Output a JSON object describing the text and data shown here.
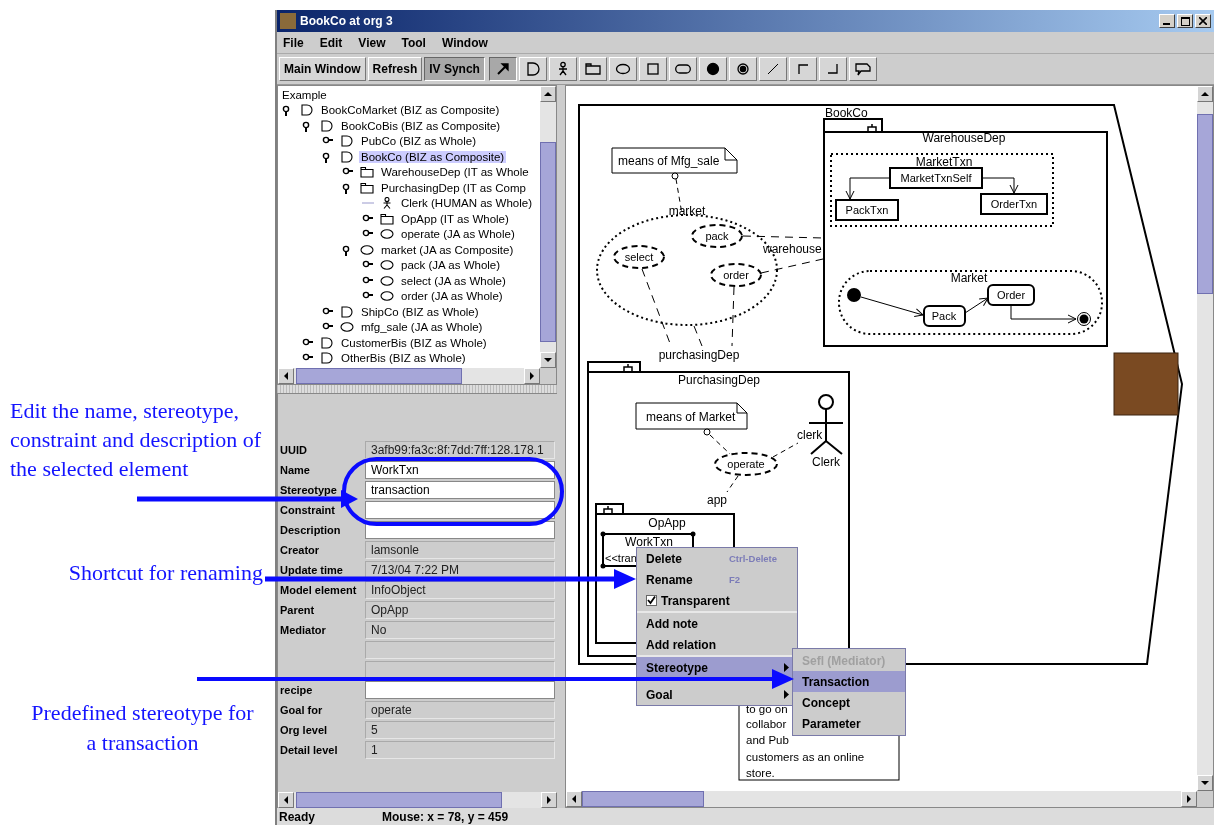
{
  "annotations": [
    "Edit the name, stereotype, constraint and description of the selected element",
    "Shortcut for renaming",
    "Predefined stereotype for a transaction"
  ],
  "window": {
    "title": "BookCo at org 3"
  },
  "menu": [
    "File",
    "Edit",
    "View",
    "Tool",
    "Window"
  ],
  "toolbar": {
    "buttons": [
      {
        "label": "Main Window",
        "pressed": false
      },
      {
        "label": "Refresh",
        "pressed": false
      },
      {
        "label": "IV Synch",
        "pressed": true
      }
    ],
    "tools": [
      {
        "kind": "pointer",
        "selected": true
      },
      {
        "kind": "business",
        "selected": false
      },
      {
        "kind": "actor",
        "selected": false
      },
      {
        "kind": "package",
        "selected": false
      },
      {
        "kind": "ellipse",
        "selected": false
      },
      {
        "kind": "square",
        "selected": false
      },
      {
        "kind": "rounded",
        "selected": false
      },
      {
        "kind": "initial",
        "selected": false
      },
      {
        "kind": "final",
        "selected": false
      },
      {
        "kind": "line",
        "selected": false
      },
      {
        "kind": "corner-top",
        "selected": false
      },
      {
        "kind": "corner-bottom",
        "selected": false
      },
      {
        "kind": "note",
        "selected": false
      }
    ]
  },
  "tree": {
    "root": "Example",
    "items": [
      {
        "label": "BookCoMarket (BIZ as Composite)",
        "kind": "biz",
        "expanded": true,
        "selected": false,
        "children": [
          {
            "label": "BookCoBis (BIZ as Composite)",
            "kind": "biz",
            "expanded": true,
            "selected": false,
            "children": [
              {
                "label": "PubCo (BIZ as Whole)",
                "kind": "biz",
                "expanded": false,
                "selected": false
              },
              {
                "label": "BookCo (BIZ as Composite)",
                "kind": "biz",
                "expanded": true,
                "selected": true,
                "children": [
                  {
                    "label": "WarehouseDep (IT as Whole",
                    "kind": "it",
                    "expanded": false,
                    "selected": false
                  },
                  {
                    "label": "PurchasingDep (IT as Comp",
                    "kind": "it",
                    "expanded": true,
                    "selected": false,
                    "children": [
                      {
                        "label": "Clerk (HUMAN as Whole)",
                        "kind": "human",
                        "selected": false
                      },
                      {
                        "label": "OpApp (IT as Whole)",
                        "kind": "it",
                        "expanded": false,
                        "selected": false
                      },
                      {
                        "label": "operate (JA as Whole)",
                        "kind": "ja",
                        "expanded": false,
                        "selected": false
                      }
                    ]
                  },
                  {
                    "label": "market (JA as Composite)",
                    "kind": "ja",
                    "expanded": true,
                    "selected": false,
                    "children": [
                      {
                        "label": "pack (JA as Whole)",
                        "kind": "ja",
                        "expanded": false,
                        "selected": false
                      },
                      {
                        "label": "select (JA as Whole)",
                        "kind": "ja",
                        "expanded": false,
                        "selected": false
                      },
                      {
                        "label": "order (JA as Whole)",
                        "kind": "ja",
                        "expanded": false,
                        "selected": false
                      }
                    ]
                  }
                ]
              },
              {
                "label": "ShipCo (BIZ as Whole)",
                "kind": "biz",
                "expanded": false,
                "selected": false
              },
              {
                "label": "mfg_sale (JA as Whole)",
                "kind": "ja",
                "expanded": false,
                "selected": false
              }
            ]
          },
          {
            "label": "CustomerBis (BIZ as Whole)",
            "kind": "biz",
            "expanded": false,
            "selected": false
          },
          {
            "label": "OtherBis (BIZ as Whole)",
            "kind": "biz",
            "expanded": false,
            "selected": false
          }
        ]
      }
    ]
  },
  "properties": [
    {
      "label": "UUID",
      "value": "3afb99:fa3c:8f:7dd:7ff:128.178.1",
      "editable": false
    },
    {
      "label": "Name",
      "value": "WorkTxn",
      "editable": true
    },
    {
      "label": "Stereotype",
      "value": "transaction",
      "editable": true
    },
    {
      "label": "Constraint",
      "editable": true
    },
    {
      "label": "Description",
      "editable": true
    },
    {
      "label": "Creator",
      "value": "lamsonle",
      "editable": false
    },
    {
      "label": "Update time",
      "value": "7/13/04 7:22 PM",
      "editable": false
    },
    {
      "label": "Model element",
      "value": "InfoObject",
      "editable": false
    },
    {
      "label": "Parent",
      "value": "OpApp",
      "editable": false
    },
    {
      "label": "Mediator",
      "value": "No",
      "editable": false
    },
    {
      "editable": false
    },
    {
      "editable": false
    },
    {
      "label": "recipe",
      "editable": true
    },
    {
      "label": "Goal for",
      "value": "operate",
      "editable": false
    },
    {
      "label": "Org level",
      "value": "5",
      "editable": false
    },
    {
      "label": "Detail level",
      "value": "1",
      "editable": false
    }
  ],
  "diagram": {
    "bookco": {
      "title": "BookCo",
      "label": "WarehouseDep",
      "composite": {
        "label": "MarketTxn",
        "parent": "MarketTxnSelf",
        "children": [
          "PackTxn",
          "OrderTxn"
        ]
      },
      "statechart": {
        "label": "Market",
        "states": [
          "Pack",
          "Order"
        ]
      }
    },
    "market_note": "means of Mfg_sale",
    "market": {
      "label": "market",
      "actions": [
        "pack",
        "select",
        "order"
      ]
    },
    "roles": [
      "warehouse",
      "purchasingDep"
    ],
    "purchasing": {
      "label": "PurchasingDep",
      "note": "means of Market",
      "action": "operate",
      "clerk_role": "clerk",
      "actor": "Clerk",
      "app_role": "app",
      "opapp": {
        "label": "OpApp",
        "object": "WorkTxn",
        "stereotype": "<<tran"
      }
    },
    "note_fragment": [
      "to go on",
      "collabor",
      "and Pub",
      "customers as an online",
      "store."
    ]
  },
  "context_menu": {
    "groups": [
      [
        {
          "label": "Delete",
          "shortcut": "Ctrl-Delete",
          "kind": "action",
          "selected": false
        },
        {
          "label": "Rename",
          "shortcut": "F2",
          "kind": "action",
          "selected": false
        },
        {
          "label": "Transparent",
          "kind": "check",
          "checked": true,
          "selected": false
        }
      ],
      [
        {
          "label": "Add note",
          "kind": "action",
          "selected": false
        },
        {
          "label": "Add relation",
          "kind": "action",
          "selected": false
        }
      ],
      [
        {
          "label": "Stereotype",
          "kind": "submenu",
          "selected": true
        },
        {
          "label": "Goal",
          "kind": "submenu",
          "selected": false
        }
      ]
    ],
    "submenu": [
      {
        "label": "Sefl (Mediator)",
        "selected": false,
        "disabled": true
      },
      {
        "label": "Transaction",
        "selected": true,
        "disabled": false
      },
      {
        "label": "Concept",
        "selected": false,
        "disabled": false
      },
      {
        "label": "Parameter",
        "selected": false,
        "disabled": false
      }
    ]
  },
  "status_bar": {
    "state": "Ready",
    "mouse": "Mouse: x = 78, y = 459"
  }
}
